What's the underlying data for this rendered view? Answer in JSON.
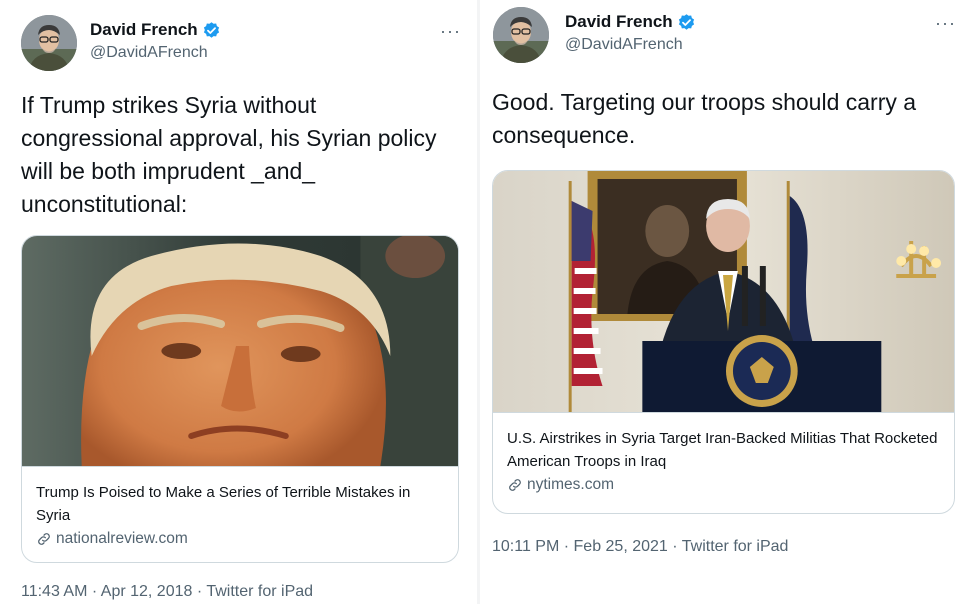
{
  "tweets": [
    {
      "author": {
        "name": "David French",
        "handle": "@DavidAFrench"
      },
      "more_label": "···",
      "text": "If Trump strikes Syria without congressional approval, his Syrian policy will be both imprudent _and_ unconstitutional:",
      "card": {
        "title": "Trump Is Poised to Make a Series of Terrible Mistakes in Syria",
        "domain": "nationalreview.com"
      },
      "meta": {
        "time": "11:43 AM",
        "sep1": " · ",
        "date": "Apr 12, 2018",
        "sep2": " · ",
        "client": "Twitter for iPad"
      }
    },
    {
      "author": {
        "name": "David French",
        "handle": "@DavidAFrench"
      },
      "more_label": "···",
      "text": "Good. Targeting our troops should carry a consequence.",
      "card": {
        "title": "U.S. Airstrikes in Syria Target Iran-Backed Militias That Rocketed American Troops in Iraq",
        "domain": "nytimes.com"
      },
      "meta": {
        "time": "10:11 PM",
        "sep1": " · ",
        "date": "Feb 25, 2021",
        "sep2": " · ",
        "client": "Twitter for iPad"
      }
    }
  ],
  "colors": {
    "verified": "#1d9bf0",
    "secondary_text": "#536471",
    "border": "#cfd9de"
  },
  "icons": [
    "avatar",
    "verified-badge-icon",
    "more-options-icon",
    "link-icon"
  ]
}
